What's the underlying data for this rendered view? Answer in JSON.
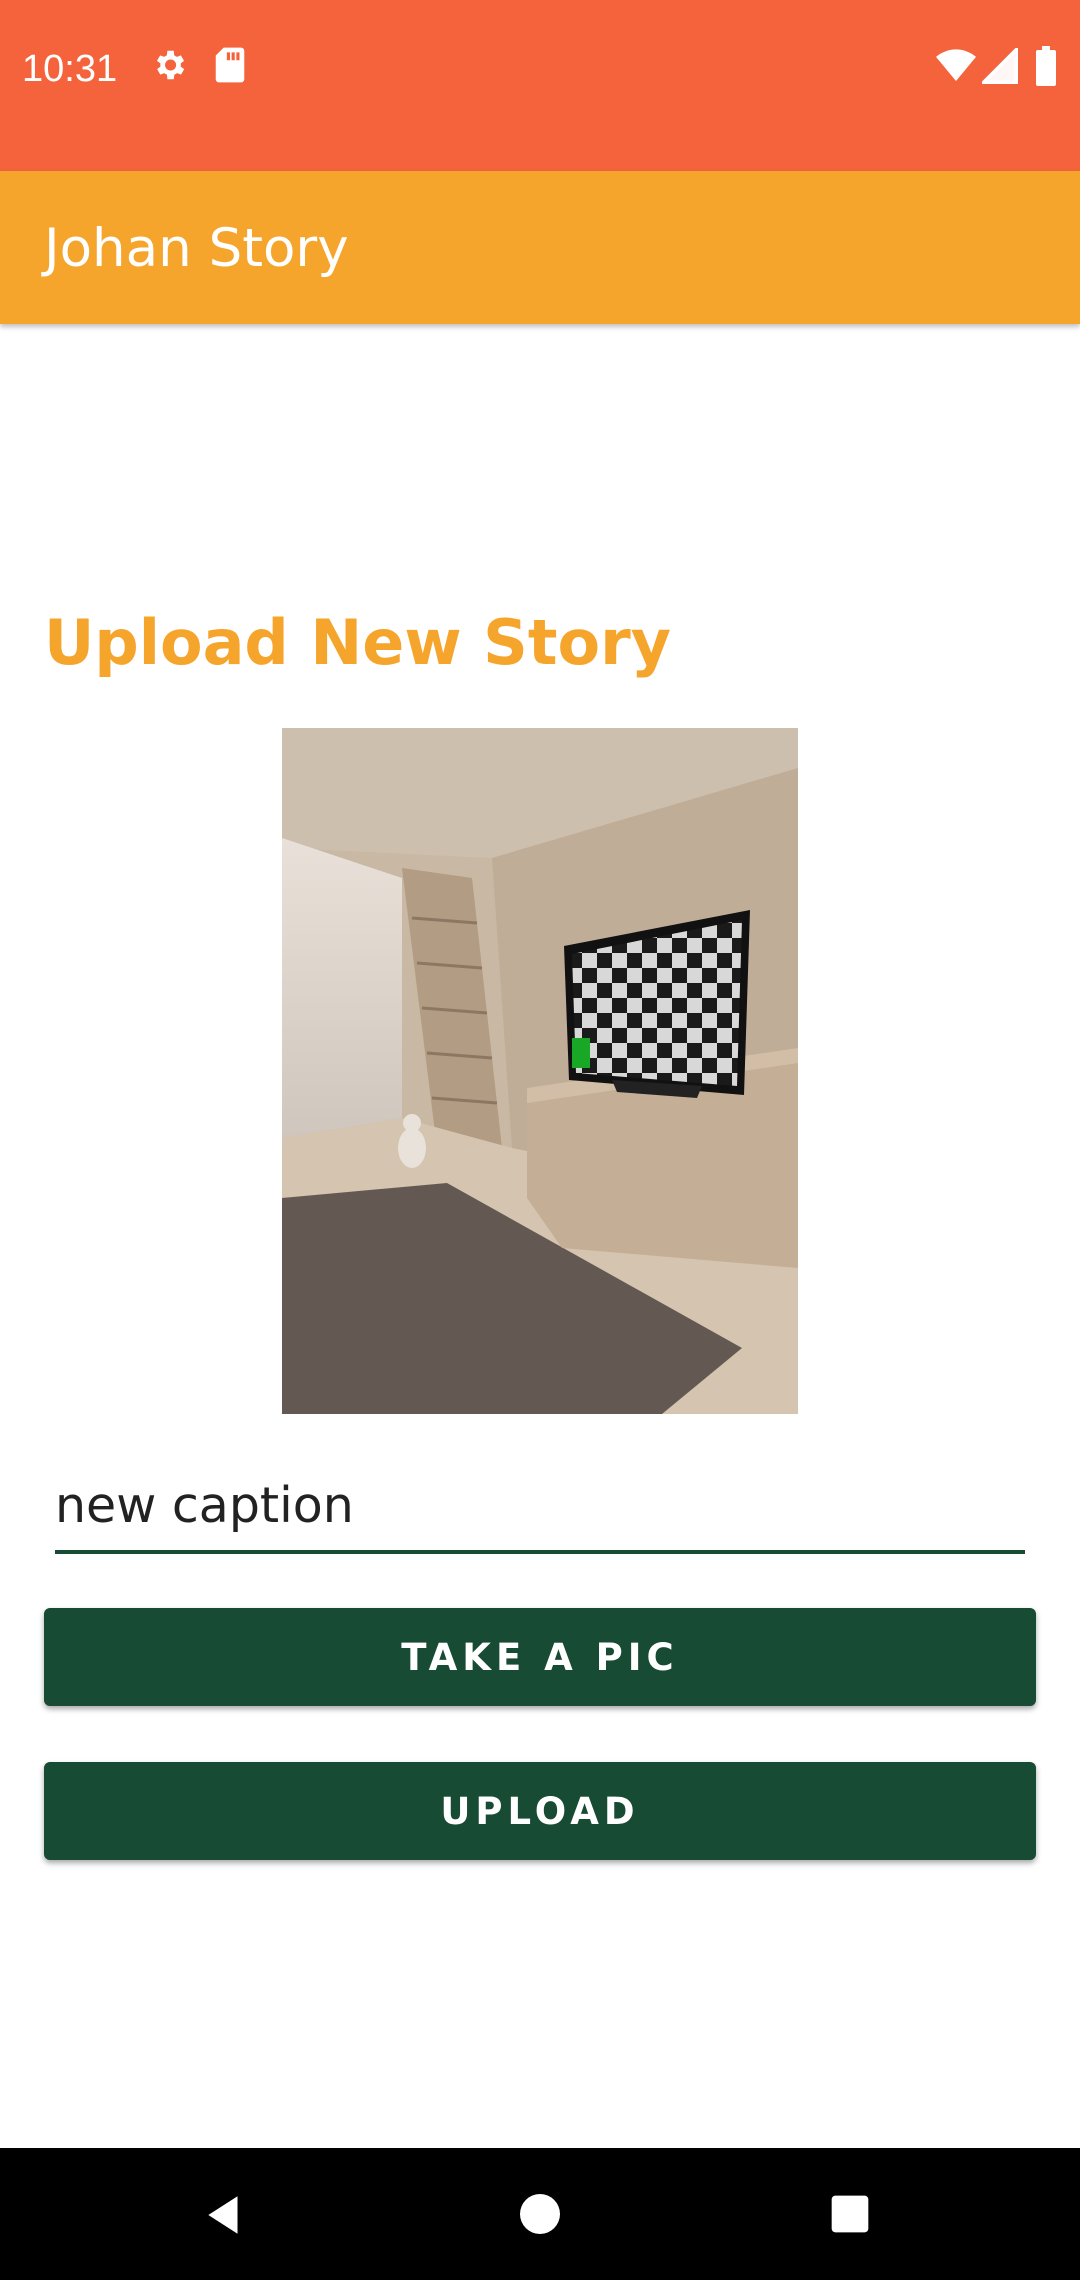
{
  "status_bar": {
    "time": "10:31",
    "left_icons": [
      "gear-icon",
      "sd-card-icon"
    ],
    "right_icons": [
      "wifi-icon",
      "cell-signal-icon",
      "battery-icon"
    ],
    "color": "#f5633d"
  },
  "app_bar": {
    "title": "Johan Story",
    "color": "#f5a52b"
  },
  "main": {
    "heading": "Upload New Story",
    "heading_color": "#f5a52b",
    "image": "living-room-photo",
    "caption_value": "new caption",
    "take_pic_label": "TAKE A PIC",
    "upload_label": "UPLOAD",
    "button_color": "#174b33"
  },
  "nav_bar": {
    "buttons": [
      "back-icon",
      "home-icon",
      "recents-icon"
    ]
  }
}
